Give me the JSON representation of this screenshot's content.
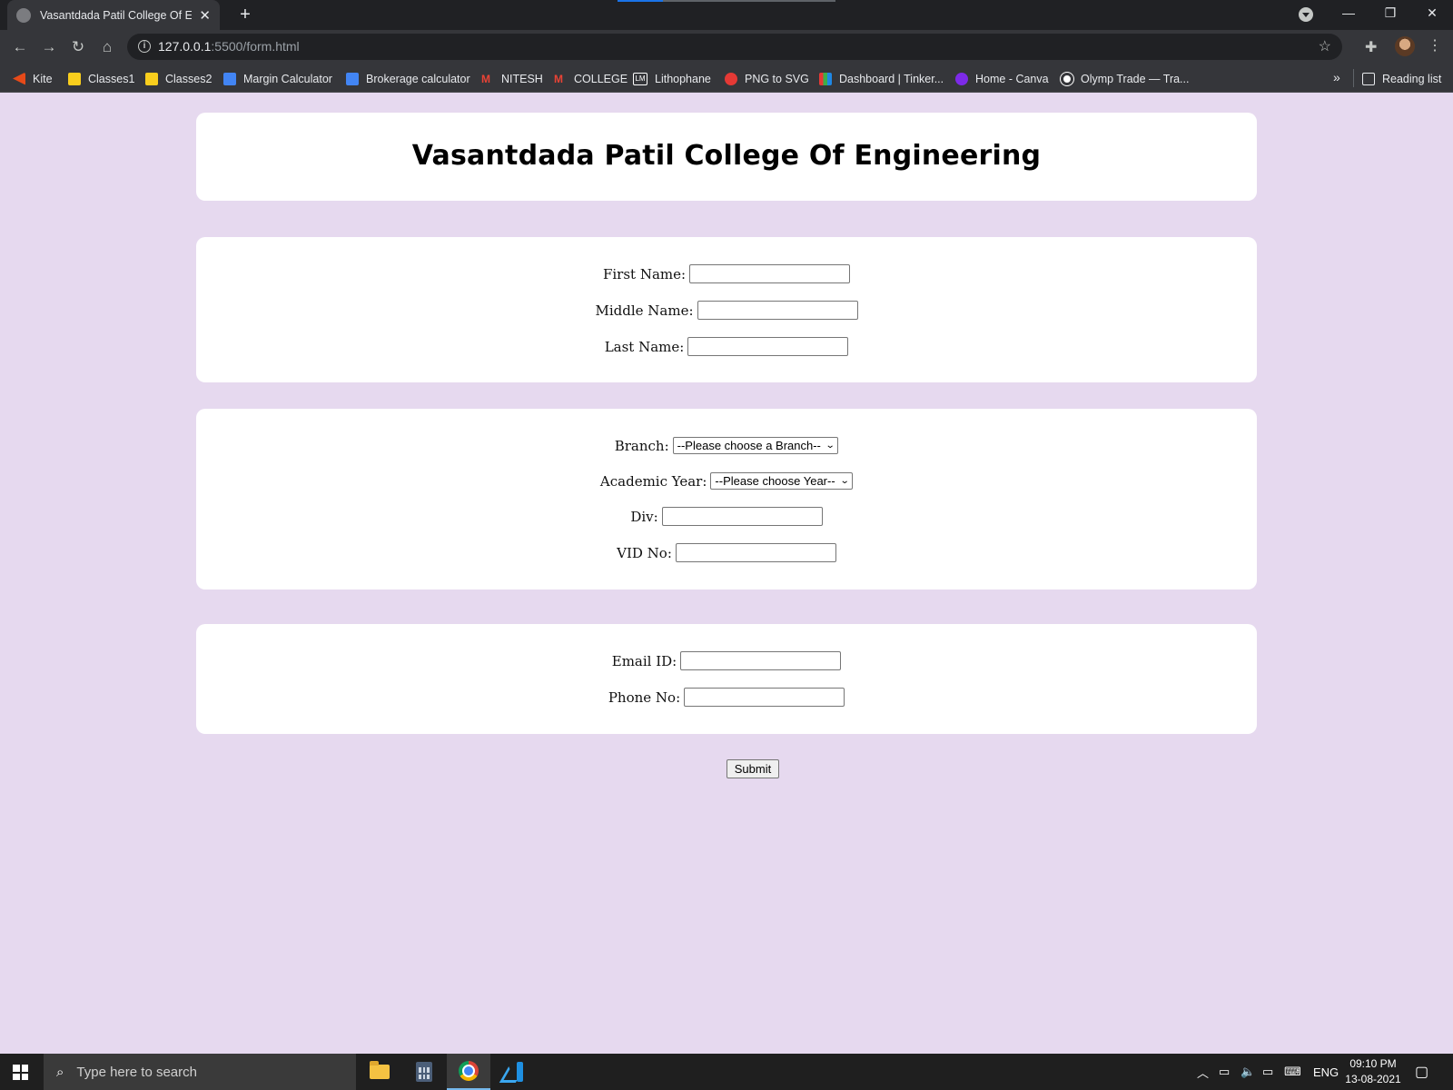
{
  "browser": {
    "tab_title": "Vasantdada Patil College Of Engineering",
    "new_tab_label": "+",
    "address": {
      "host": "127.0.0.1",
      "rest": ":5500/form.html"
    },
    "bookmarks": [
      {
        "label": "Kite",
        "icon": "kite-icon",
        "color": "#e64a19"
      },
      {
        "label": "Classes1",
        "icon": "classroom-icon",
        "color": "#f9ce1d"
      },
      {
        "label": "Classes2",
        "icon": "classroom-icon",
        "color": "#f9ce1d"
      },
      {
        "label": "Margin Calculator",
        "icon": "doc-icon",
        "color": "#4285f4"
      },
      {
        "label": "Brokerage calculator",
        "icon": "doc-icon",
        "color": "#4285f4"
      },
      {
        "label": "NITESH",
        "icon": "gmail-icon",
        "color": "#ea4335"
      },
      {
        "label": "COLLEGE",
        "icon": "gmail-icon",
        "color": "#ea4335"
      },
      {
        "label": "Lithophane",
        "icon": "lm-icon",
        "color": "#ffffff"
      },
      {
        "label": "PNG to SVG",
        "icon": "png-svg-icon",
        "color": "#e53935"
      },
      {
        "label": "Dashboard | Tinker...",
        "icon": "tinkercad-icon",
        "color": "#3dae49"
      },
      {
        "label": "Home - Canva",
        "icon": "canva-icon",
        "color": "#7d2ae8"
      },
      {
        "label": "Olymp Trade — Tra...",
        "icon": "olymp-icon",
        "color": "#ffffff"
      }
    ],
    "reading_list": "Reading list"
  },
  "page": {
    "title": "Vasantdada Patil College Of Engineering",
    "name_section": {
      "first_name": "First Name:",
      "middle_name": "Middle Name:",
      "last_name": "Last Name:"
    },
    "academic_section": {
      "branch": "Branch:",
      "branch_select": "--Please choose a Branch--",
      "year": "Academic Year:",
      "year_select": "--Please choose Year--",
      "div": "Div:",
      "vid": "VID No:"
    },
    "contact_section": {
      "email": "Email ID:",
      "phone": "Phone No:"
    },
    "submit": "Submit",
    "background_color": "#e6d9ef"
  },
  "taskbar": {
    "search_placeholder": "Type here to search",
    "language": "ENG",
    "time": "09:10 PM",
    "date": "13-08-2021"
  }
}
